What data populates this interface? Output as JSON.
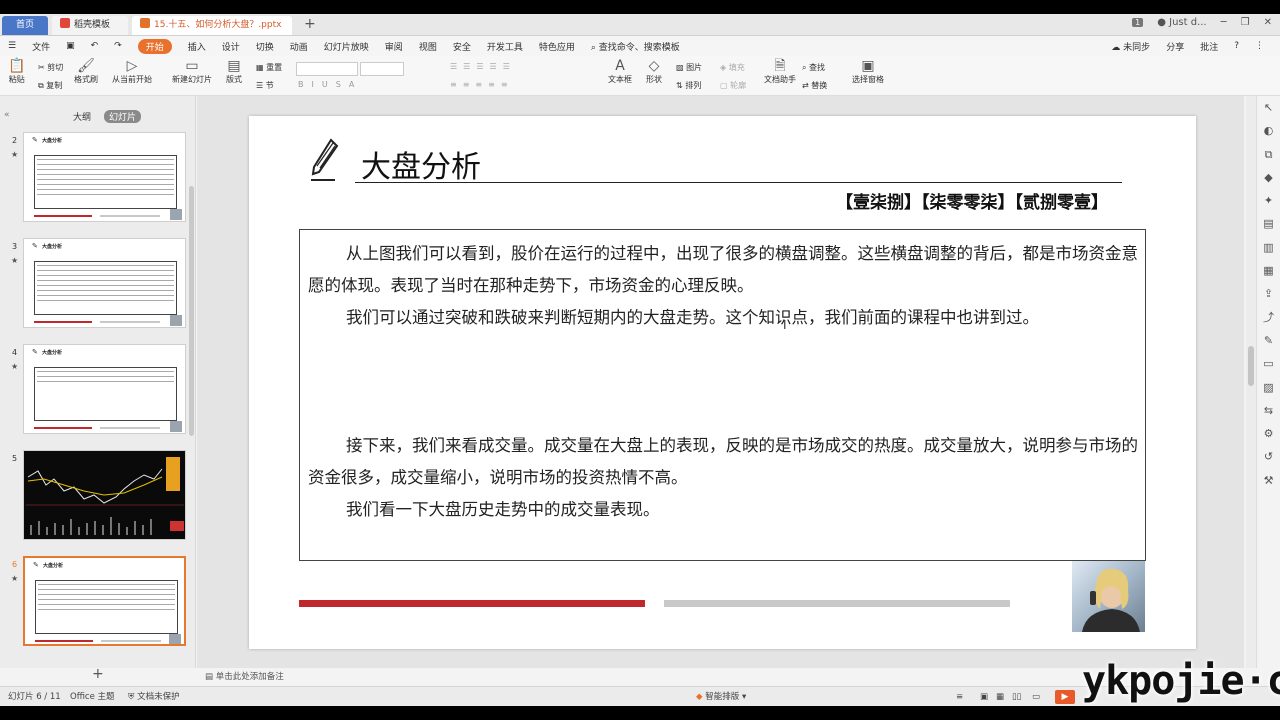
{
  "titlebar": {
    "home_tab": "首页",
    "template_tab": "稻壳模板",
    "doc_tab": "15.十五、如何分析大盘？.pptx",
    "new_tab": "+",
    "page_count": "1",
    "user": "Just d..."
  },
  "menu": {
    "file": "文件",
    "items": [
      "开始",
      "插入",
      "设计",
      "切换",
      "动画",
      "幻灯片放映",
      "审阅",
      "视图",
      "安全",
      "开发工具",
      "特色应用"
    ],
    "search": "查找命令、搜索模板",
    "sync": "未同步",
    "share": "分享",
    "comment": "批注"
  },
  "ribbon": {
    "paste": "粘贴",
    "cut": "剪切",
    "copy": "复制",
    "format_painter": "格式刷",
    "from_current": "从当前开始",
    "new_slide": "新建幻灯片",
    "layout": "版式",
    "reset": "重置",
    "section": "节",
    "textbox": "文本框",
    "shape": "形状",
    "arrange": "排列",
    "picture": "图片",
    "fill": "填充",
    "outline": "轮廓",
    "text_assistant": "文档助手",
    "find": "查找",
    "replace": "替换",
    "select_pane": "选择窗格"
  },
  "leftpanel": {
    "outline_tab": "大纲",
    "slides_tab": "幻灯片",
    "thumbs": [
      {
        "num": "2",
        "title": "大盘分析"
      },
      {
        "num": "3",
        "title": "大盘分析"
      },
      {
        "num": "4",
        "title": "大盘分析"
      },
      {
        "num": "5",
        "title": ""
      },
      {
        "num": "6",
        "title": "大盘分析"
      }
    ],
    "add": "+"
  },
  "slide": {
    "title": "大盘分析",
    "subtitle": "【壹柒捌】【柒零零柒】【贰捌零壹】",
    "paragraphs": [
      "从上图我们可以看到，股价在运行的过程中，出现了很多的横盘调整。这些横盘调整的背后，都是市场资金意愿的体现。表现了当时在那种走势下，市场资金的心理反映。",
      "我们可以通过突破和跌破来判断短期内的大盘走势。这个知识点，我们前面的课程中也讲到过。",
      "",
      "接下来，我们来看成交量。成交量在大盘上的表现，反映的是市场成交的热度。成交量放大，说明参与市场的资金很多，成交量缩小，说明市场的投资热情不高。",
      "我们看一下大盘历史走势中的成交量表现。"
    ]
  },
  "notes": {
    "placeholder": "单击此处添加备注"
  },
  "status": {
    "slide_index": "幻灯片 6 / 11",
    "theme": "Office 主题",
    "protect": "文档未保护",
    "smart": "智能排版"
  },
  "watermark": "ykpojie·com",
  "colors": {
    "accent": "#e9712d",
    "red_bar": "#c0282d",
    "gray_bar": "#c9c9c9",
    "home_tab": "#4a76c8"
  }
}
